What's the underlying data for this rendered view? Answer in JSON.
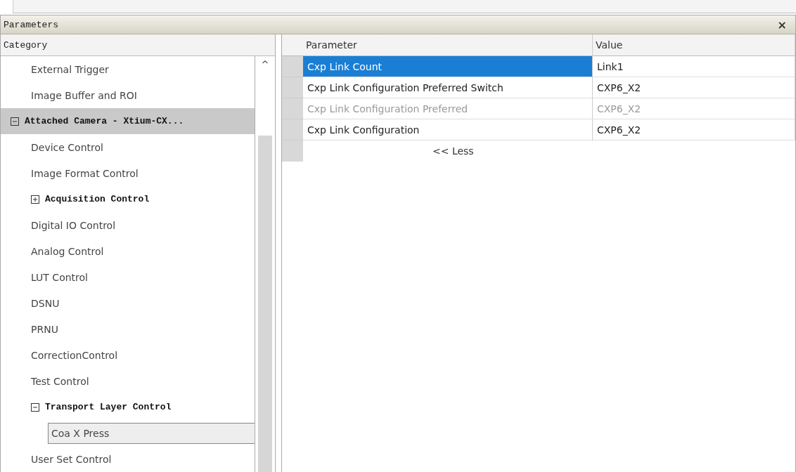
{
  "window": {
    "title": "Parameters",
    "close": "×"
  },
  "category": {
    "header": "Category",
    "scroll_up": "^",
    "continued_items": [
      {
        "label": "External Trigger",
        "bold": false,
        "selected": false,
        "highlighted": false
      },
      {
        "label": "Image Buffer and ROI",
        "bold": false,
        "selected": false,
        "highlighted": false
      }
    ],
    "items": [
      {
        "label": "Attached Camera - Xtium-CX...",
        "bold": true,
        "expanded": true,
        "selected": false,
        "highlighted": true,
        "children": [
          {
            "label": "Device Control",
            "bold": false,
            "selected": false,
            "highlighted": false
          },
          {
            "label": "Image Format Control",
            "bold": false,
            "selected": false,
            "highlighted": false
          },
          {
            "label": "Acquisition Control",
            "bold": true,
            "expanded": false,
            "selected": false,
            "highlighted": false
          },
          {
            "label": "Digital IO Control",
            "bold": false,
            "selected": false,
            "highlighted": false
          },
          {
            "label": "Analog Control",
            "bold": false,
            "selected": false,
            "highlighted": false
          },
          {
            "label": "LUT Control",
            "bold": false,
            "selected": false,
            "highlighted": false
          },
          {
            "label": "DSNU",
            "bold": false,
            "selected": false,
            "highlighted": false
          },
          {
            "label": "PRNU",
            "bold": false,
            "selected": false,
            "highlighted": false
          },
          {
            "label": "CorrectionControl",
            "bold": false,
            "selected": false,
            "highlighted": false
          },
          {
            "label": "Test Control",
            "bold": false,
            "selected": false,
            "highlighted": false
          },
          {
            "label": "Transport Layer Control",
            "bold": true,
            "expanded": true,
            "selected": false,
            "highlighted": false,
            "children": [
              {
                "label": "Coa X Press",
                "bold": false,
                "selected": true,
                "highlighted": false
              }
            ]
          },
          {
            "label": "User Set Control",
            "bold": false,
            "selected": false,
            "highlighted": false
          }
        ]
      }
    ]
  },
  "table": {
    "columns": [
      "Parameter",
      "Value"
    ],
    "rows": [
      {
        "parameter": "Cxp Link Count",
        "value": "Link1",
        "selected": true,
        "disabled": false
      },
      {
        "parameter": "Cxp Link Configuration Preferred Switch",
        "value": "CXP6_X2",
        "selected": false,
        "disabled": false
      },
      {
        "parameter": "Cxp Link Configuration Preferred",
        "value": "CXP6_X2",
        "selected": false,
        "disabled": true
      },
      {
        "parameter": "Cxp Link Configuration",
        "value": "CXP6_X2",
        "selected": false,
        "disabled": false
      }
    ],
    "less_link": "<< Less"
  }
}
